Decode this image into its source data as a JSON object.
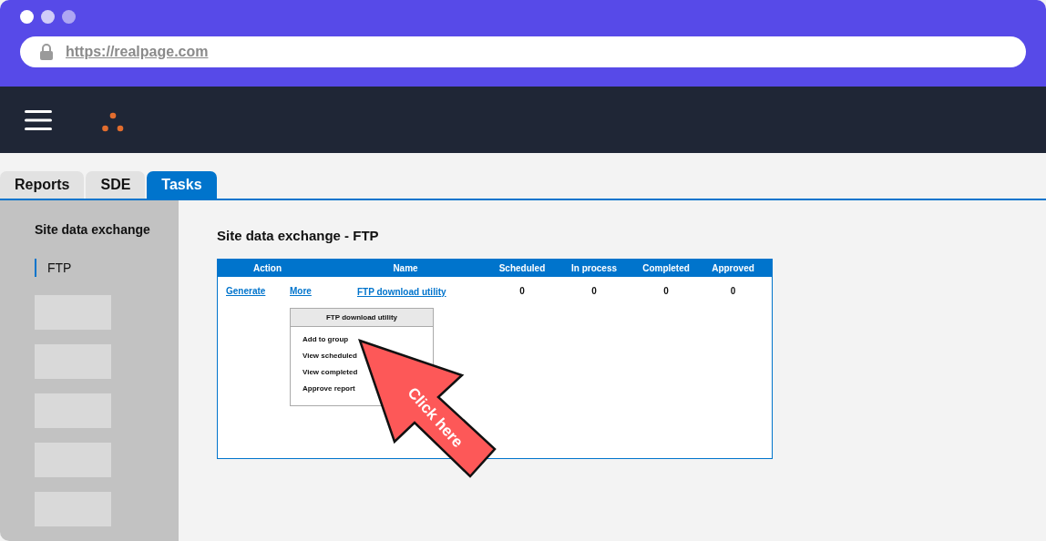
{
  "browser": {
    "url": "https://realpage.com"
  },
  "tabs": [
    {
      "label": "Reports",
      "selected": false
    },
    {
      "label": "SDE",
      "selected": false
    },
    {
      "label": "Tasks",
      "selected": true
    }
  ],
  "sidebar": {
    "title": "Site data exchange",
    "items": [
      {
        "kind": "link",
        "label": "FTP",
        "selected": true
      },
      {
        "kind": "placeholder"
      },
      {
        "kind": "placeholder"
      },
      {
        "kind": "placeholder"
      },
      {
        "kind": "placeholder"
      },
      {
        "kind": "placeholder"
      }
    ]
  },
  "page_title": "Site data exchange - FTP",
  "table": {
    "columns": [
      "Action",
      "Name",
      "Scheduled",
      "In process",
      "Completed",
      "Approved"
    ],
    "rows": [
      {
        "actions": [
          "Generate",
          "More"
        ],
        "name": "FTP download utility",
        "scheduled": "0",
        "in_process": "0",
        "completed": "0",
        "approved": "0"
      }
    ]
  },
  "menu": {
    "title": "FTP download utility",
    "items": [
      "Add to group",
      "View scheduled",
      "View completed",
      "Approve report"
    ]
  },
  "callout": {
    "label": "Click here"
  }
}
